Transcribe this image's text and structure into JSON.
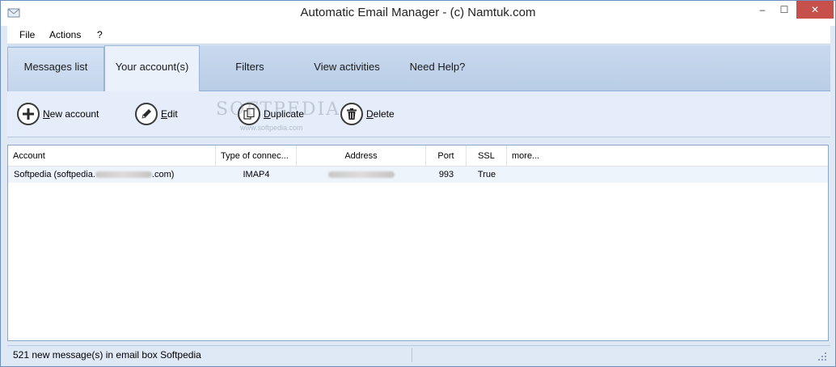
{
  "window": {
    "title": "Automatic Email Manager - (c) Namtuk.com",
    "minimize_glyph": "–",
    "maximize_glyph": "☐",
    "close_glyph": "✕"
  },
  "menu": {
    "items": [
      {
        "label": "File"
      },
      {
        "label": "Actions"
      },
      {
        "label": "?"
      }
    ]
  },
  "tabs": [
    {
      "label": "Messages list",
      "active": false
    },
    {
      "label": "Your account(s)",
      "active": true
    },
    {
      "label": "Filters",
      "active": false
    },
    {
      "label": "View activities",
      "active": false
    },
    {
      "label": "Need Help?",
      "active": false
    }
  ],
  "toolbar": {
    "new_account": {
      "label": "New account",
      "icon": "plus-icon"
    },
    "edit": {
      "label": "Edit",
      "icon": "pencil-icon"
    },
    "duplicate": {
      "label": "Duplicate",
      "icon": "copy-icon"
    },
    "delete": {
      "label": "Delete",
      "icon": "trash-icon"
    }
  },
  "watermark": {
    "main": "SOFTPEDIA",
    "sub": "www.softpedia.com"
  },
  "table": {
    "columns": [
      "Account",
      "Type of connec...",
      "Address",
      "Port",
      "SSL",
      "more..."
    ],
    "rows": [
      {
        "account_prefix": "Softpedia (softpedia.",
        "account_suffix": ".com)",
        "type": "IMAP4",
        "port": "993",
        "ssl": "True"
      }
    ]
  },
  "status": {
    "message": "521 new message(s) in email box Softpedia"
  },
  "colors": {
    "accent": "#c7504b",
    "tab_bg": "#c3d5ec",
    "row_selected": "#eef4fb"
  }
}
